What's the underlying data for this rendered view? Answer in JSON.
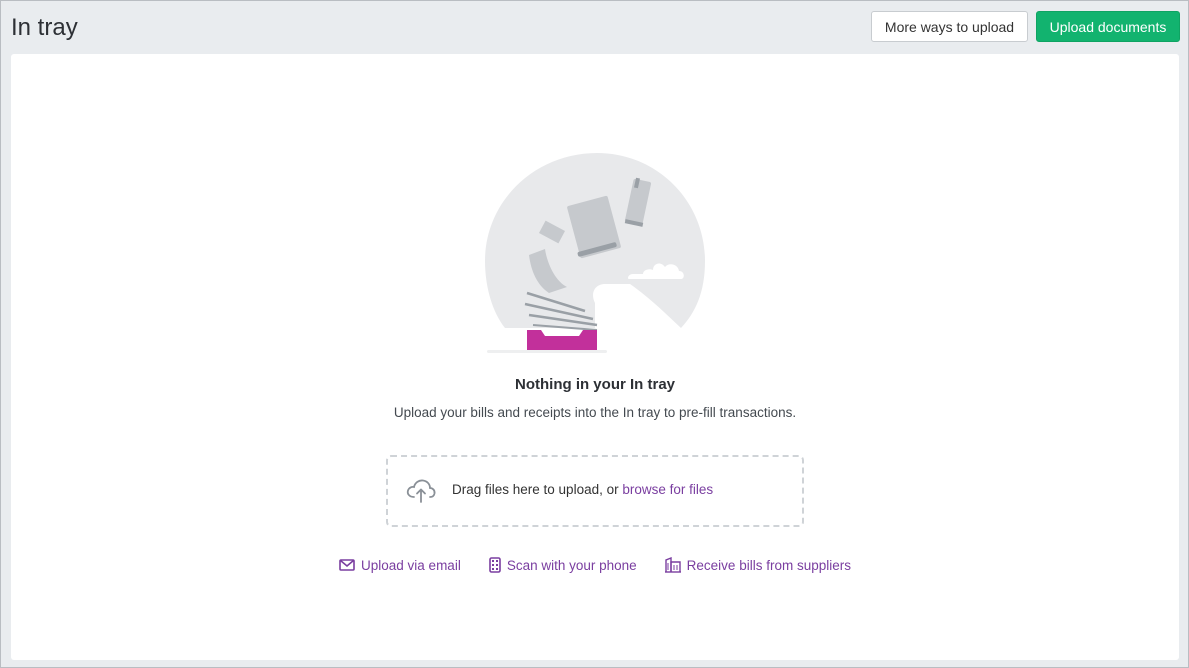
{
  "header": {
    "title": "In tray",
    "more_ways_label": "More ways to upload",
    "upload_label": "Upload documents"
  },
  "empty_state": {
    "title": "Nothing in your In tray",
    "subtitle": "Upload your bills and receipts into the In tray to pre-fill transactions."
  },
  "dropzone": {
    "text": "Drag files here to upload, or",
    "browse_link": "browse for files",
    "icon": "cloud-upload-icon"
  },
  "links": [
    {
      "label": "Upload via email",
      "icon": "envelope-icon"
    },
    {
      "label": "Scan with your phone",
      "icon": "phone-icon"
    },
    {
      "label": "Receive bills from suppliers",
      "icon": "building-icon"
    }
  ],
  "colors": {
    "primary": "#12b36f",
    "link": "#7a3ea0",
    "tray": "#c2309b"
  }
}
